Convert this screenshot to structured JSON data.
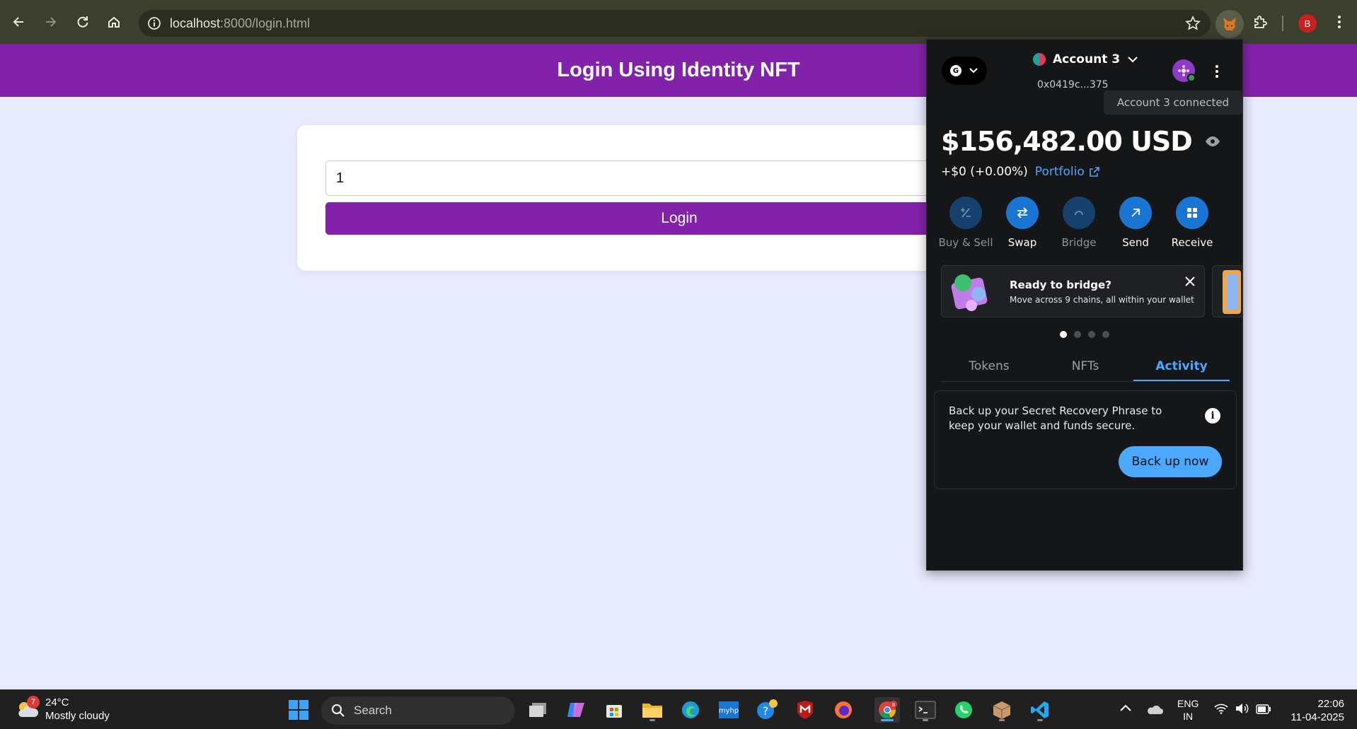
{
  "browser": {
    "url_host": "localhost",
    "url_path": ":8000/login.html",
    "profile_initial": "B"
  },
  "page": {
    "title": "Login Using Identity NFT",
    "input_value": "1",
    "login_label": "Login"
  },
  "metamask": {
    "network_initial": "G",
    "account_name": "Account 3",
    "account_address": "0x0419c...375",
    "connected_tooltip": "Account 3 connected",
    "balance": "$156,482.00 USD",
    "change": "+$0 (+0.00%)",
    "portfolio_label": "Portfolio",
    "actions": [
      {
        "label": "Buy & Sell",
        "icon": "plus-minus-icon",
        "enabled": false
      },
      {
        "label": "Swap",
        "icon": "swap-icon",
        "enabled": true
      },
      {
        "label": "Bridge",
        "icon": "bridge-icon",
        "enabled": false
      },
      {
        "label": "Send",
        "icon": "arrow-up-right-icon",
        "enabled": true
      },
      {
        "label": "Receive",
        "icon": "qr-icon",
        "enabled": true
      }
    ],
    "banner": {
      "title": "Ready to bridge?",
      "subtitle": "Move across 9 chains, all within your wallet"
    },
    "carousel_active_index": 0,
    "tabs": [
      "Tokens",
      "NFTs",
      "Activity"
    ],
    "active_tab": "Activity",
    "backup": {
      "message": "Back up your Secret Recovery Phrase to keep your wallet and funds secure.",
      "button_label": "Back up now"
    },
    "accent_color": "#4aa8ff"
  },
  "taskbar": {
    "weather_badge": "7",
    "temperature": "24°C",
    "condition": "Mostly cloudy",
    "search_placeholder": "Search",
    "language": "ENG",
    "region": "IN",
    "time": "22:06",
    "date": "11-04-2025",
    "chrome_badge": "8"
  },
  "colors": {
    "header": "#8222ab",
    "page_bg": "#e8ebfd",
    "chrome_bar": "#3c3f2e"
  }
}
